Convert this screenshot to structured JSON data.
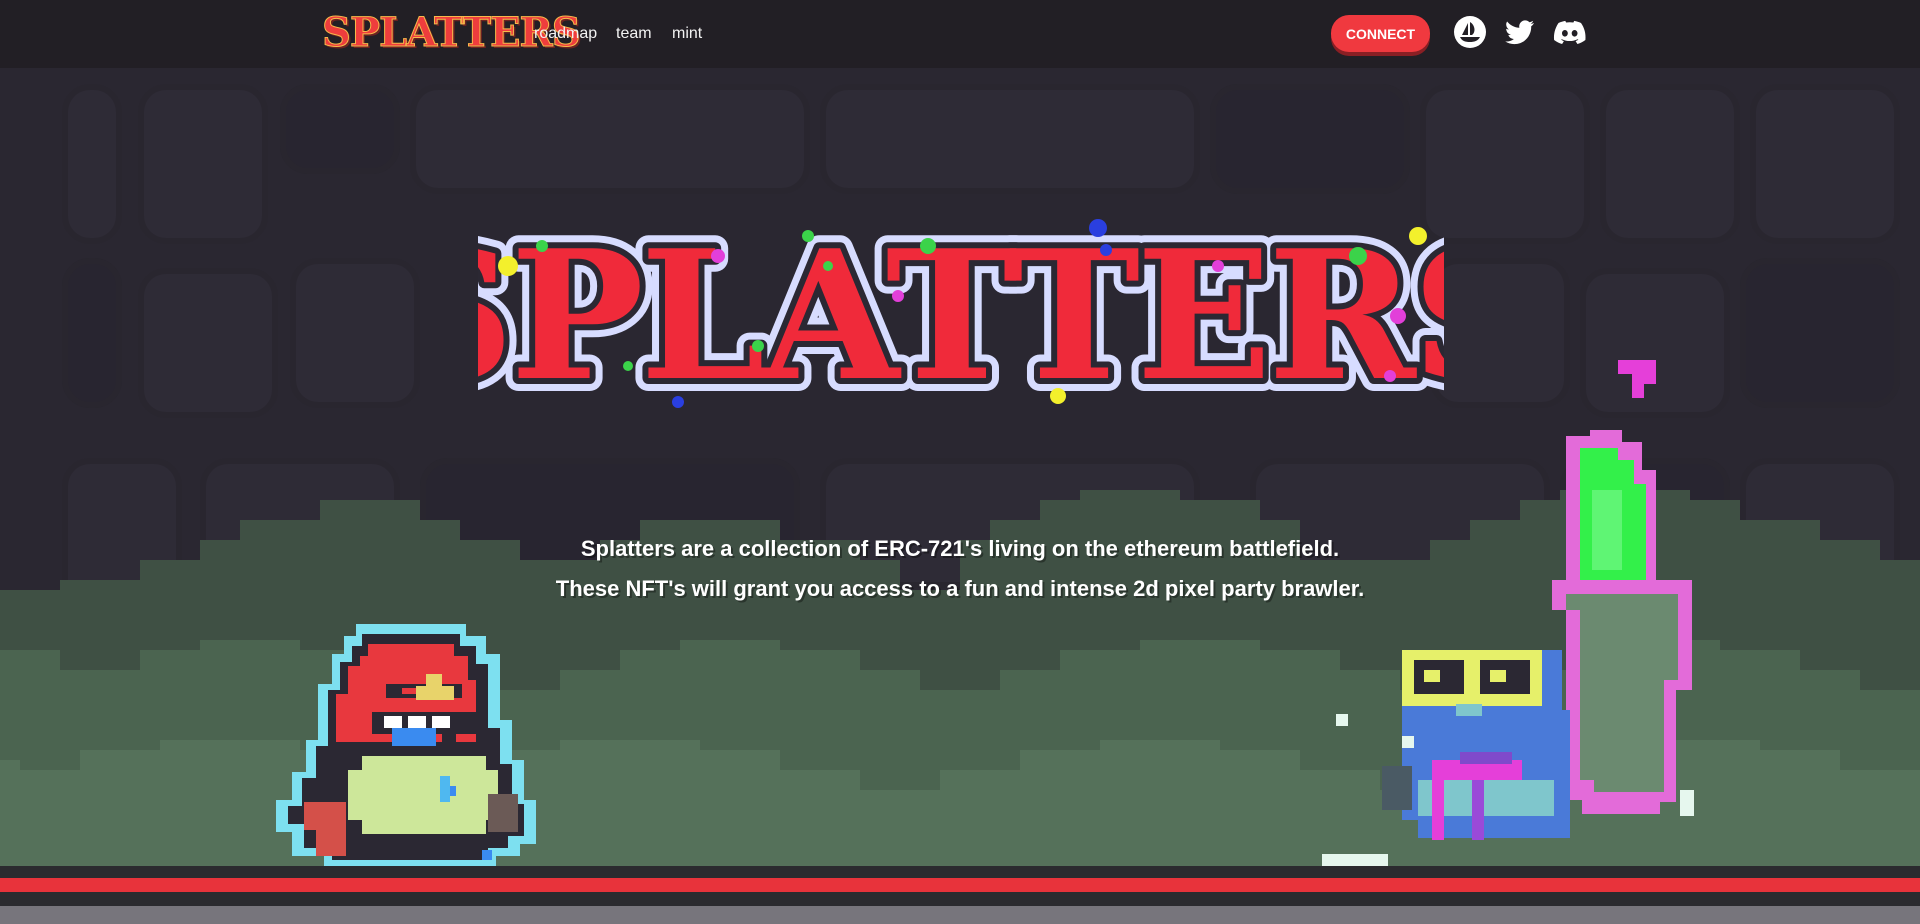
{
  "nav": {
    "logo_text": "SPLATTERS",
    "links": [
      "roadmap",
      "team",
      "mint"
    ],
    "connect_label": "CONNECT",
    "social_icons": [
      "opensea-icon",
      "twitter-icon",
      "discord-icon"
    ]
  },
  "hero": {
    "title": "SPLATTERS",
    "tagline_line1": "Splatters are a collection of ERC-721's living on the ethereum battlefield.",
    "tagline_line2": "These NFT's will grant you access to a fun and intense 2d pixel party brawler."
  },
  "colors": {
    "background": "#221f25",
    "accent_red": "#f0393f",
    "title_red": "#f02a3a",
    "title_outline": "#d7dcff",
    "hill_green": "#4f6a52",
    "stripe_red": "#e8333b",
    "stripe_gray": "#77757c"
  }
}
